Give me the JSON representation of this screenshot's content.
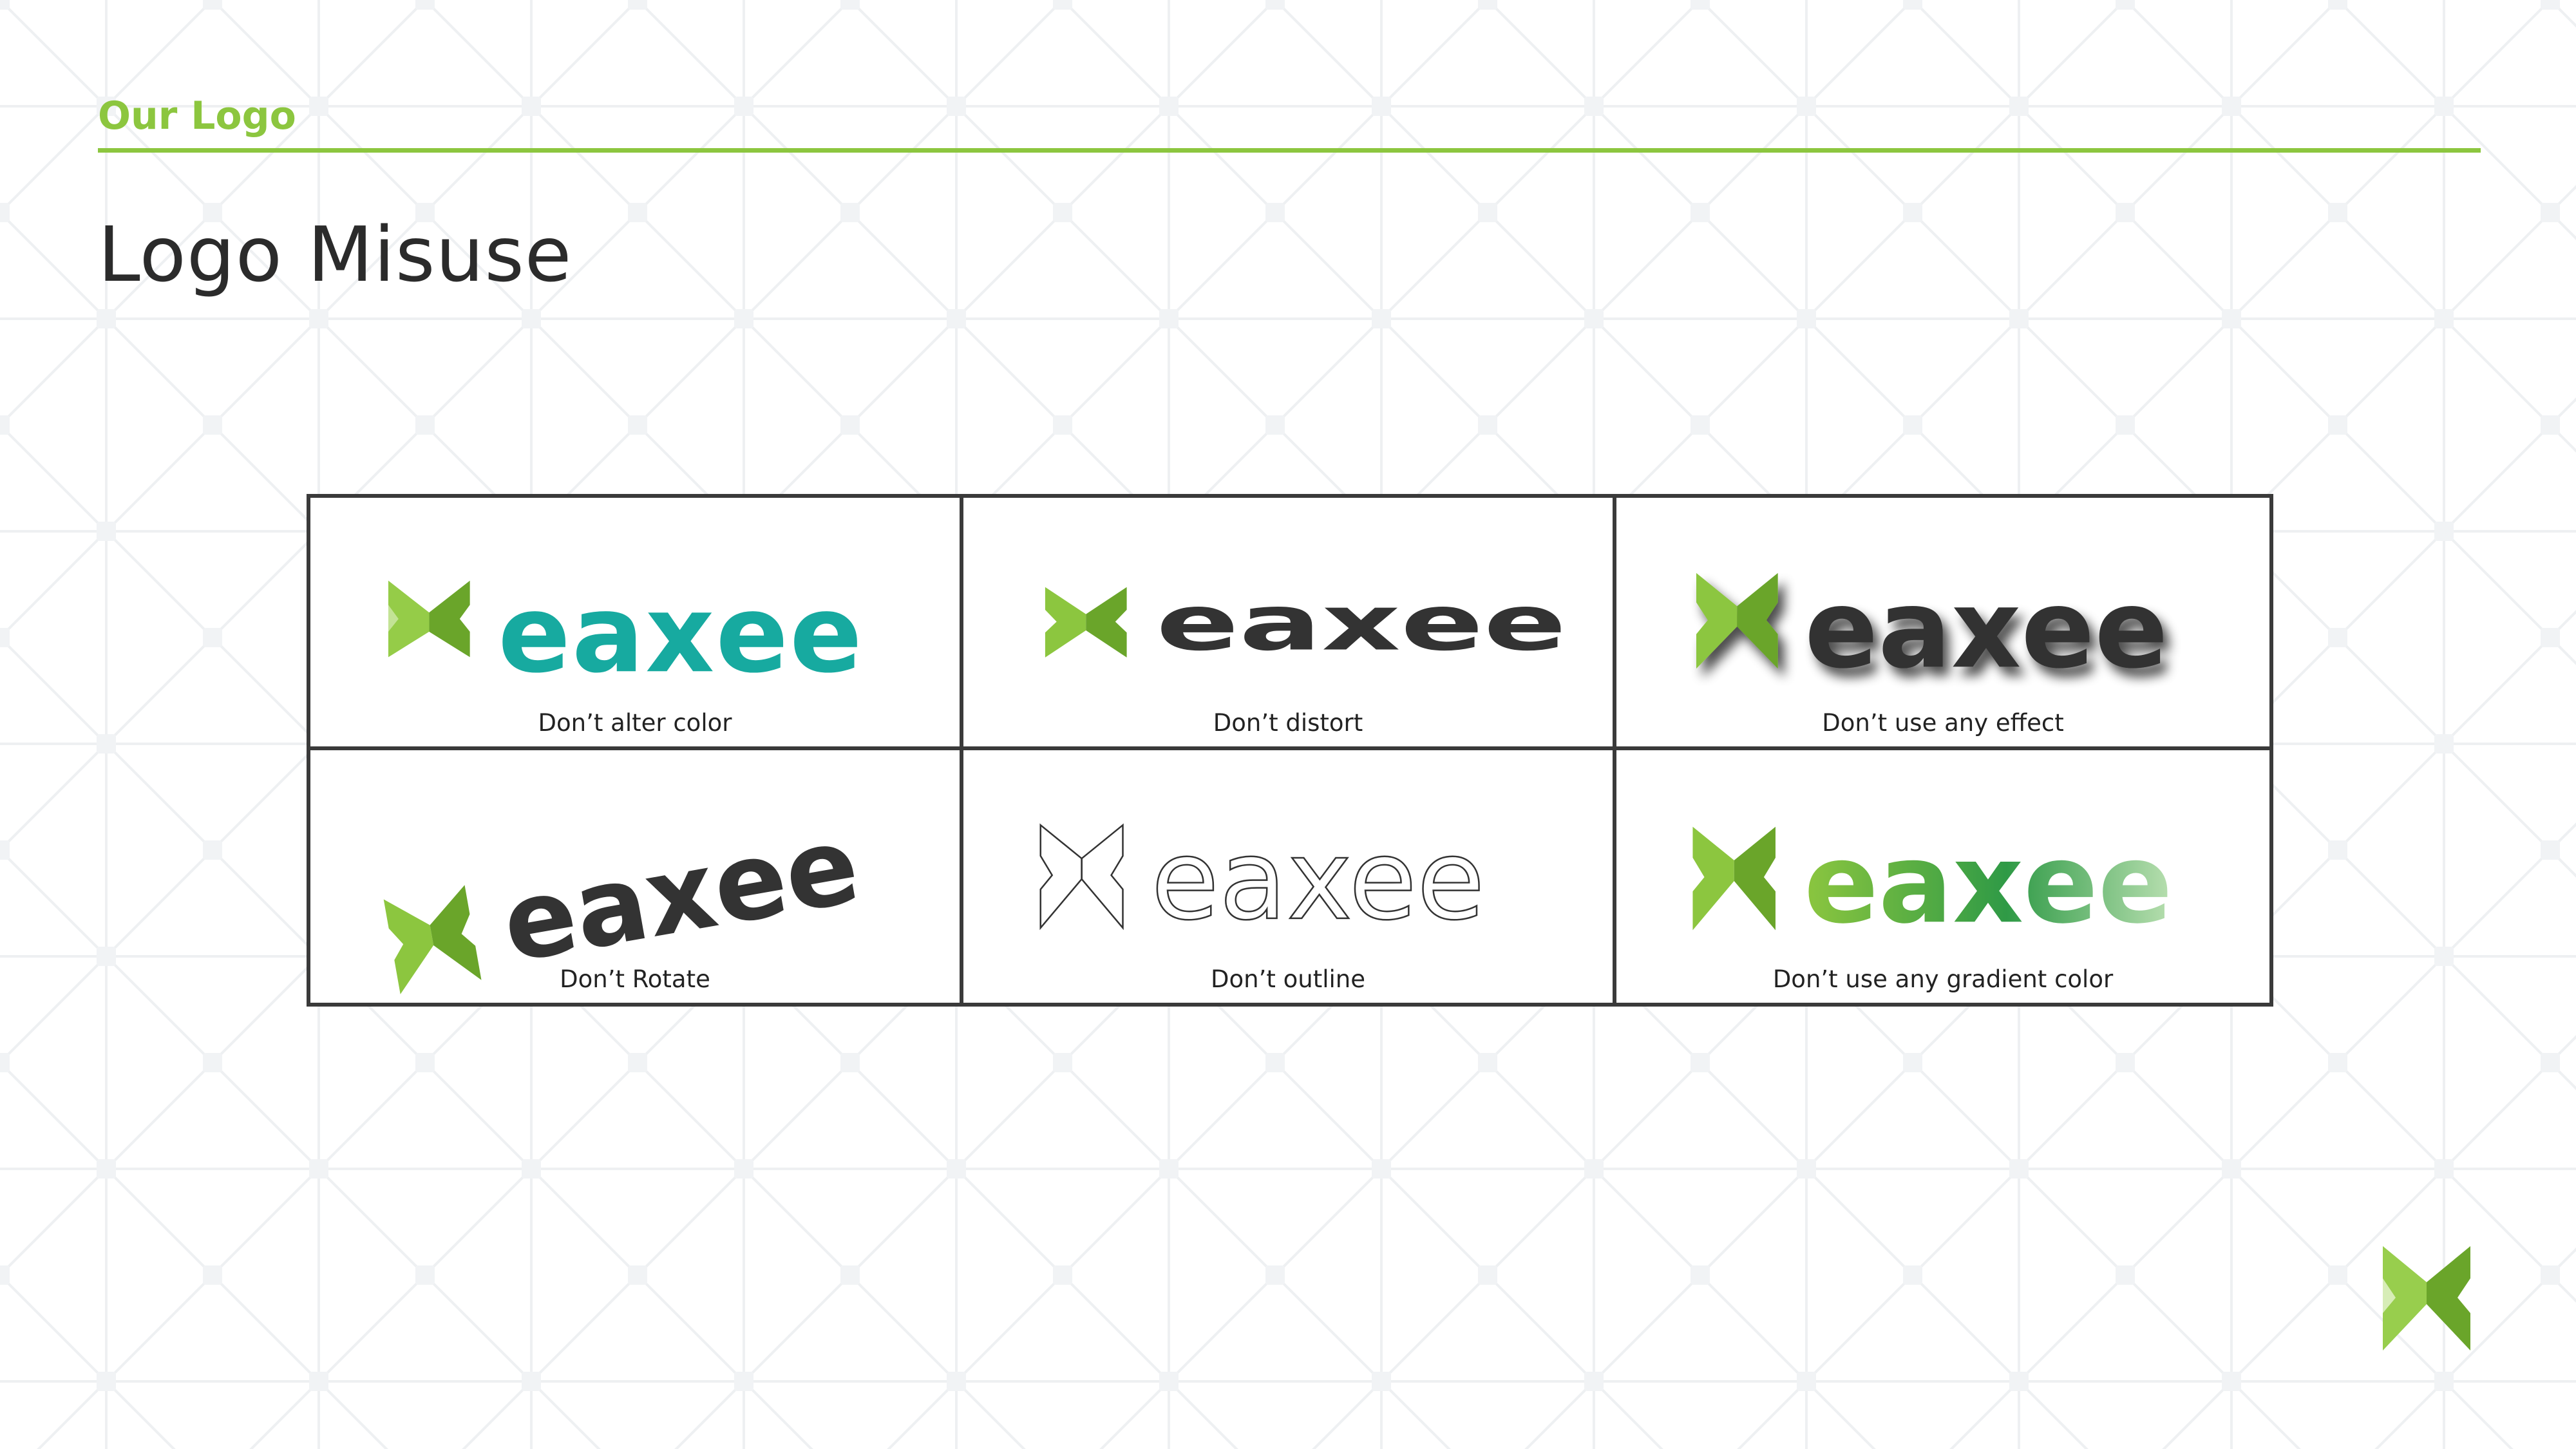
{
  "header": {
    "section_label": "Our Logo",
    "title": "Logo Misuse"
  },
  "brand": {
    "wordmark": "eaxee",
    "green": "#8cc63f",
    "green_dark": "#6aa52a",
    "dark_text": "#333333",
    "teal": "#17aaa0",
    "rule_color": "#8cc63f"
  },
  "misuse_examples": [
    {
      "id": "alter-color",
      "caption": "Don’t alter color",
      "wordmark": "eaxee"
    },
    {
      "id": "distort",
      "caption": "Don’t distort",
      "wordmark": "eaxee"
    },
    {
      "id": "effect",
      "caption": "Don’t use any effect",
      "wordmark": "eaxee"
    },
    {
      "id": "rotate",
      "caption": "Don’t Rotate",
      "wordmark": "eaxee"
    },
    {
      "id": "outline",
      "caption": "Don’t outline",
      "wordmark": "eaxee"
    },
    {
      "id": "gradient",
      "caption": "Don’t use any gradient color",
      "wordmark": "eaxee"
    }
  ],
  "icons": {
    "brand_mark": "eaxee-x-mark-icon"
  }
}
